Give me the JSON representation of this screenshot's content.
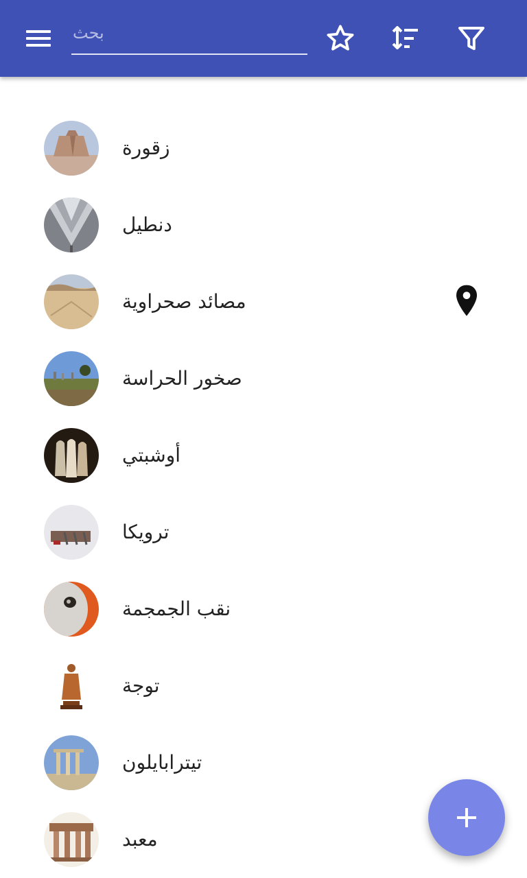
{
  "toolbar": {
    "menu_icon": "hamburger-menu-icon",
    "search_placeholder": "بحث",
    "favorite_icon": "star-outline-icon",
    "sort_icon": "sort-icon",
    "filter_icon": "filter-icon"
  },
  "items": [
    {
      "label": "زقورة",
      "thumb_icon": "ziggurat-photo"
    },
    {
      "label": "دنطيل",
      "thumb_icon": "dentil-molding-photo"
    },
    {
      "label": "مصائد صحراوية",
      "thumb_icon": "desert-kite-photo",
      "has_pin": true,
      "pin_icon": "map-pin-icon"
    },
    {
      "label": "صخور الحراسة",
      "thumb_icon": "guard-stones-photo"
    },
    {
      "label": "أوشبتي",
      "thumb_icon": "ushabti-photo"
    },
    {
      "label": "ترويكا",
      "thumb_icon": "troika-photo"
    },
    {
      "label": "نقب الجمجمة",
      "thumb_icon": "trepanation-skull-photo"
    },
    {
      "label": "توجة",
      "thumb_icon": "toga-statue-photo"
    },
    {
      "label": "تيترابايلون",
      "thumb_icon": "tetrapylon-photo"
    },
    {
      "label": "معبد",
      "thumb_icon": "temple-photo"
    }
  ],
  "fab": {
    "icon": "plus-icon"
  },
  "colors": {
    "primary": "#3f51b5",
    "accent": "#7986e8",
    "text": "#222222"
  }
}
